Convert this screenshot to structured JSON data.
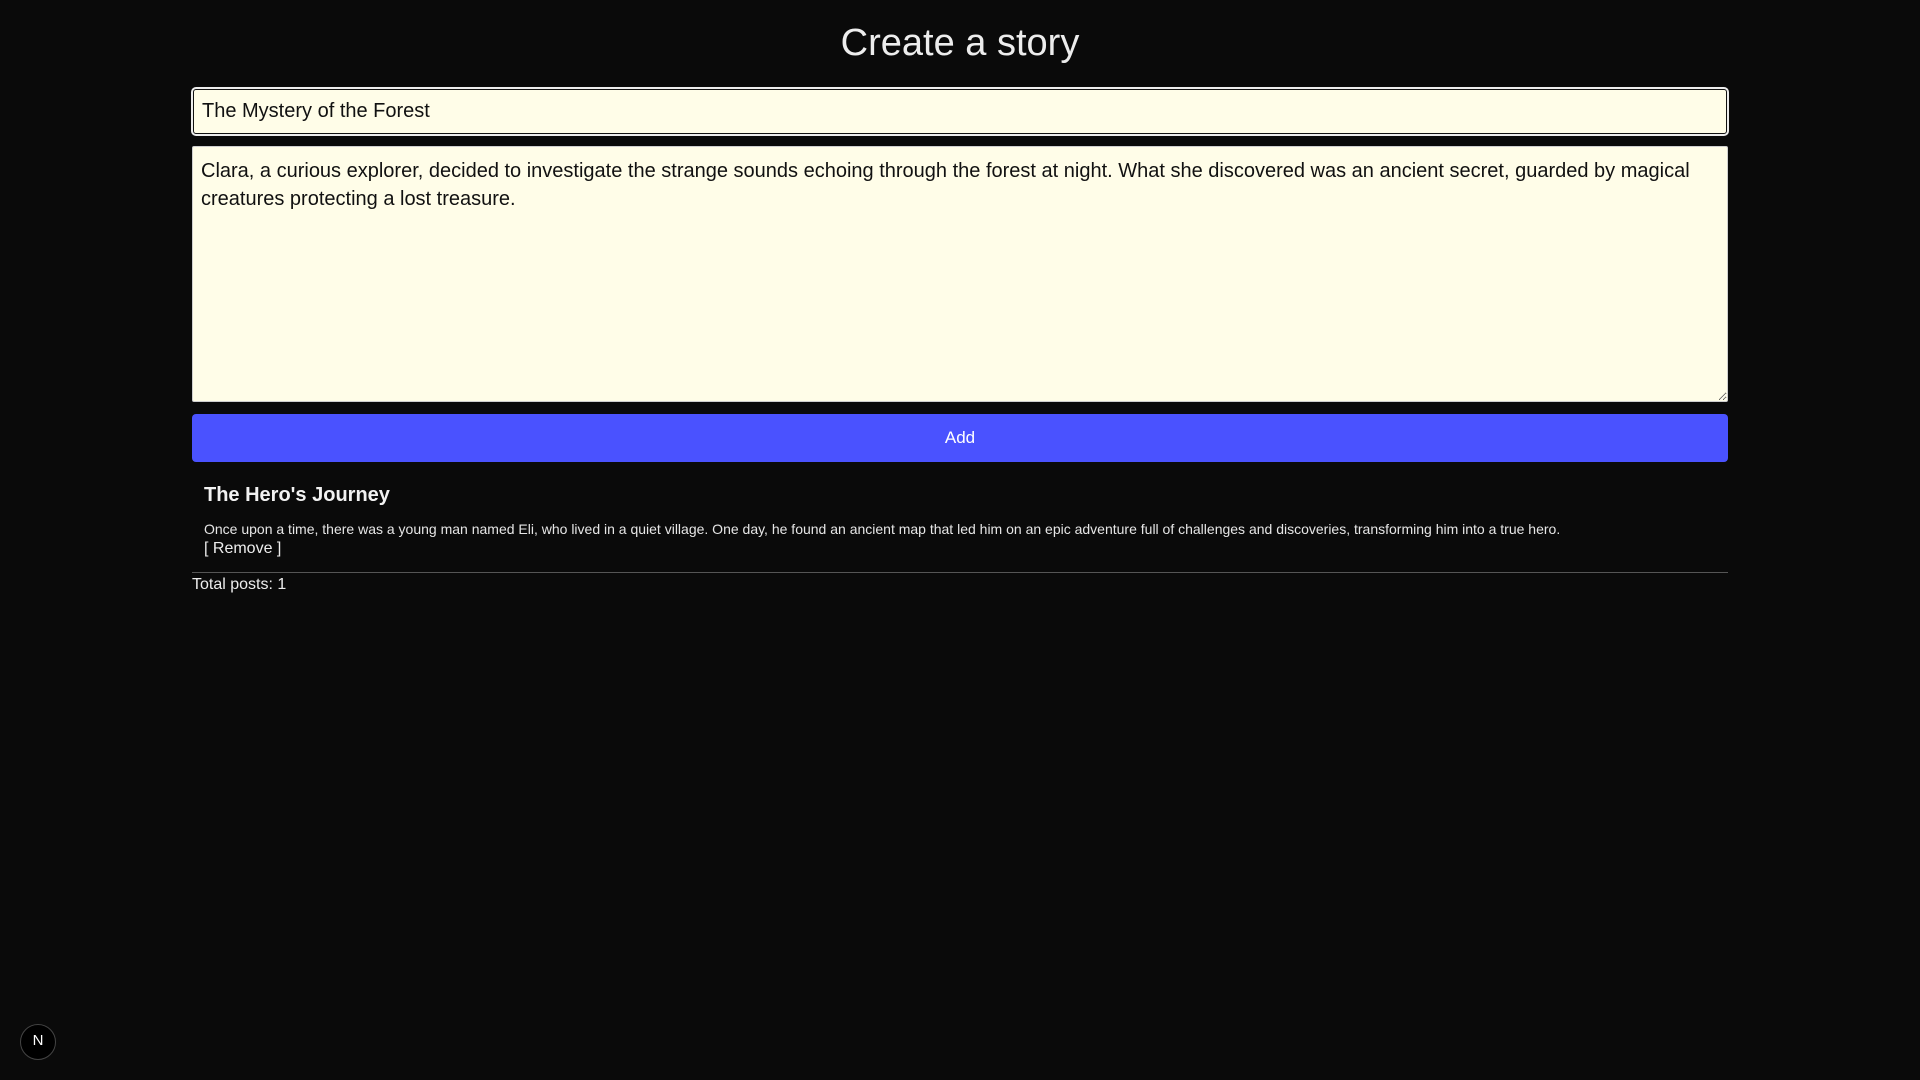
{
  "page": {
    "heading": "Create a story"
  },
  "form": {
    "title_value": "The Mystery of the Forest",
    "body_value": "Clara, a curious explorer, decided to investigate the strange sounds echoing through the forest at night. What she discovered was an ancient secret, guarded by magical creatures protecting a lost treasure.",
    "add_label": "Add",
    "add_color": "#4a52ff"
  },
  "posts": [
    {
      "title": "The Hero's Journey",
      "body": "Once upon a time, there was a young man named Eli, who lived in a quiet village. One day, he found an ancient map that led him on an epic adventure full of challenges and discoveries, transforming him into a true hero.",
      "remove_label": "[ Remove ]"
    }
  ],
  "footer": {
    "total_label": "Total posts: 1"
  },
  "dev_badge": {
    "icon": "next-logo-icon",
    "letter": "N"
  }
}
